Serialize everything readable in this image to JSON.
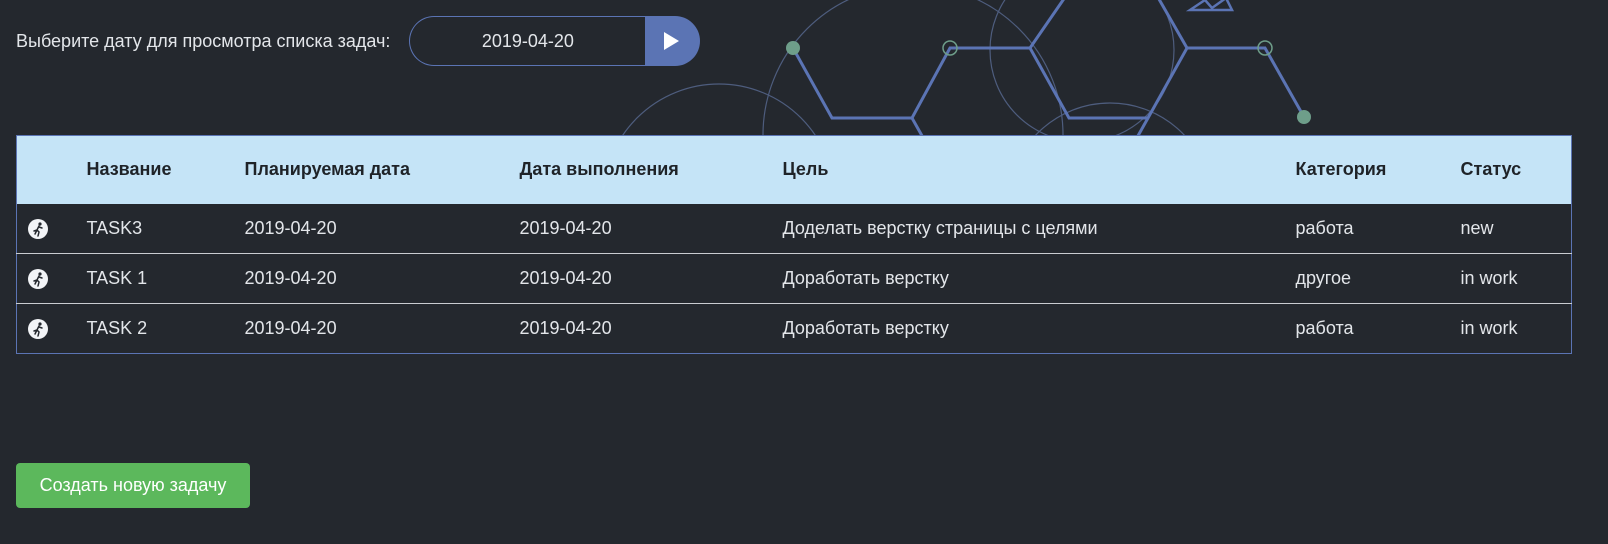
{
  "filter": {
    "label": "Выберите дату для просмотра списка задач:",
    "date_value": "2019-04-20",
    "go_icon": "play-icon"
  },
  "table": {
    "headers": [
      "Название",
      "Планируемая дата",
      "Дата выполнения",
      "Цель",
      "Категория",
      "Статус"
    ],
    "row_icon": "runner-icon",
    "rows": [
      {
        "name": "TASK3",
        "planned": "2019-04-20",
        "done": "2019-04-20",
        "goal": "Доделать верстку страницы с целями",
        "category": "работа",
        "status": "new"
      },
      {
        "name": "TASK 1",
        "planned": "2019-04-20",
        "done": "2019-04-20",
        "goal": "Доработать верстку",
        "category": "другое",
        "status": "in work"
      },
      {
        "name": "TASK 2",
        "planned": "2019-04-20",
        "done": "2019-04-20",
        "goal": "Доработать верстку",
        "category": "работа",
        "status": "in work"
      }
    ]
  },
  "actions": {
    "create_label": "Создать новую задачу"
  },
  "colors": {
    "background": "#24282e",
    "accent": "#5b74b4",
    "header_bg": "#c5e4f7",
    "success": "#5cb85c"
  }
}
